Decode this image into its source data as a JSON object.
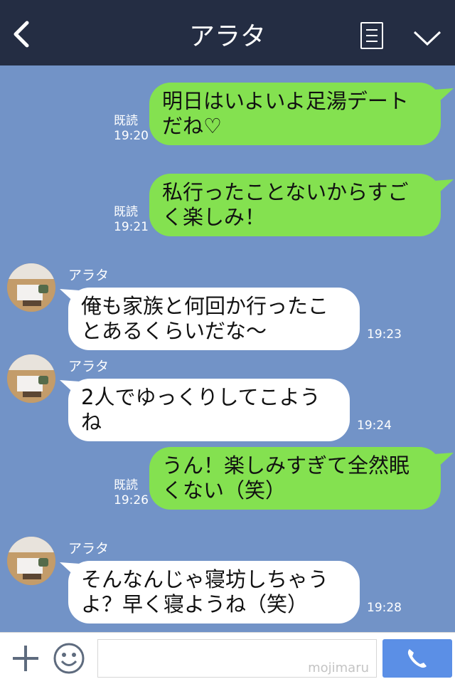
{
  "header": {
    "title": "アラタ"
  },
  "messages": [
    {
      "type": "sent",
      "text": "明日はいよいよ足湯デートだね♡",
      "read": "既読",
      "time": "19:20"
    },
    {
      "type": "sent",
      "text": "私行ったことないからすごく楽しみ！",
      "read": "既読",
      "time": "19:21"
    },
    {
      "type": "received",
      "sender": "アラタ",
      "text": "俺も家族と何回か行ったことあるくらいだな〜",
      "time": "19:23"
    },
    {
      "type": "received",
      "sender": "アラタ",
      "text": "2人でゆっくりしてこようね",
      "time": "19:24"
    },
    {
      "type": "sent",
      "text": "うん！楽しみすぎて全然眠くない（笑）",
      "read": "既読",
      "time": "19:26"
    },
    {
      "type": "received",
      "sender": "アラタ",
      "text": "そんなんじゃ寝坊しちゃうよ？早く寝ようね（笑）",
      "time": "19:28"
    }
  ],
  "footer": {
    "input_placeholder": "",
    "watermark": "mojimaru"
  },
  "colors": {
    "header_bg": "#242d43",
    "chat_bg": "#7293c7",
    "sent_bubble": "#84e150",
    "received_bubble": "#ffffff",
    "call_button": "#5b8fe6"
  }
}
